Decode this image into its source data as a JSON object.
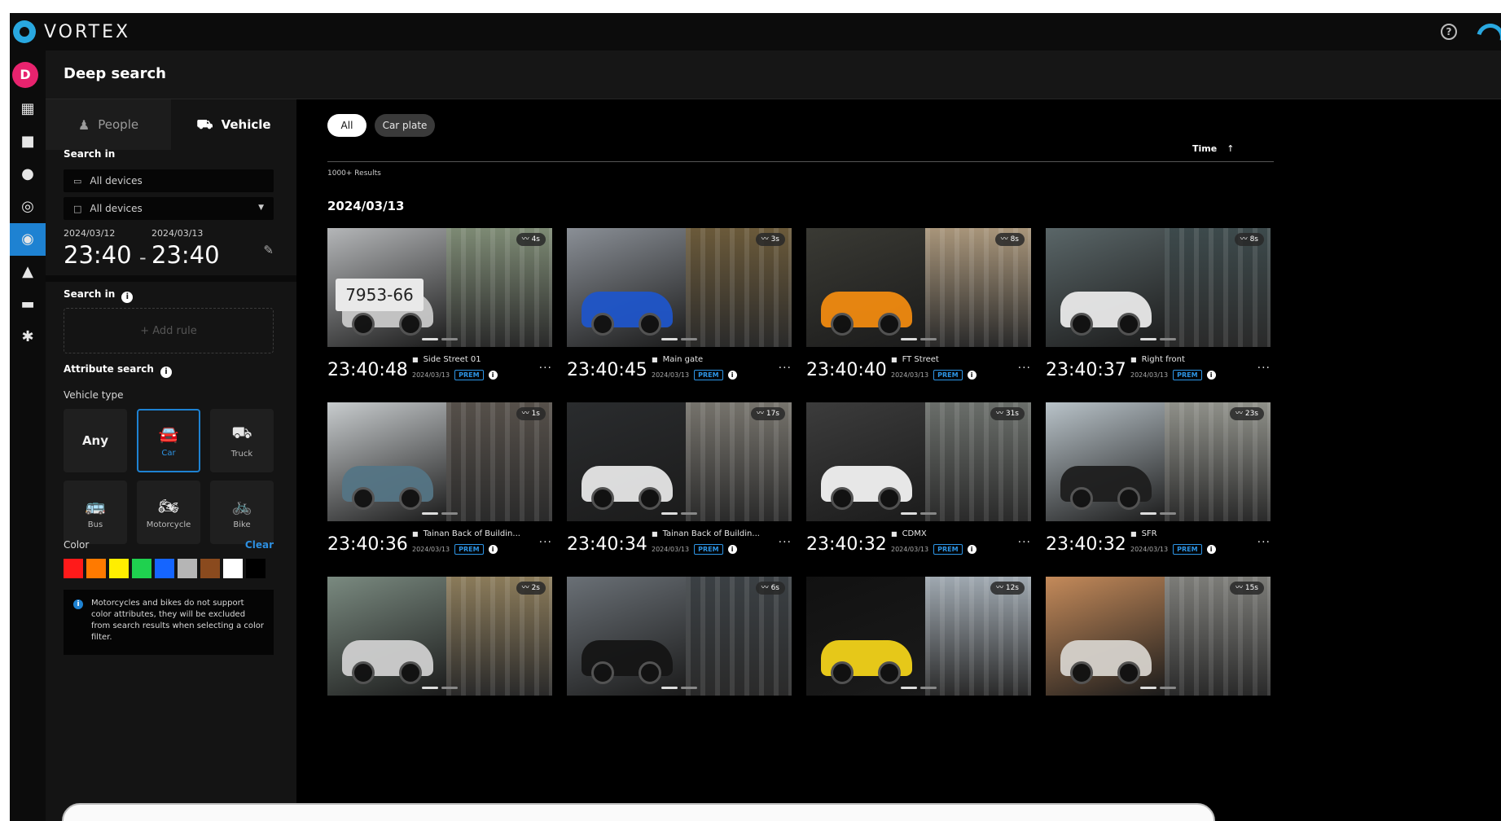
{
  "topbar": {
    "brand": "VORTEX",
    "help_icon": "?"
  },
  "rail": {
    "avatar": "D",
    "items": [
      {
        "name": "dashboard-icon",
        "glyph": "▦"
      },
      {
        "name": "camera-icon",
        "glyph": "■"
      },
      {
        "name": "person-icon",
        "glyph": "●"
      },
      {
        "name": "analytics-icon",
        "glyph": "◎"
      },
      {
        "name": "deep-search-icon",
        "glyph": "◉",
        "active": true
      },
      {
        "name": "bell-icon",
        "glyph": "▲"
      },
      {
        "name": "archive-icon",
        "glyph": "▬"
      },
      {
        "name": "settings-icon",
        "glyph": "✱"
      }
    ]
  },
  "page": {
    "title": "Deep search"
  },
  "panel": {
    "tabs": [
      {
        "label": "People",
        "icon": "♟",
        "active": false
      },
      {
        "label": "Vehicle",
        "icon": "⛟",
        "active": true
      }
    ],
    "search_in_label": "Search in",
    "devices_field_1": "All devices",
    "devices_field_2": "All devices",
    "date_from_small": "2024/03/12",
    "date_from_time": "23:40",
    "date_to_small": "2024/03/13",
    "date_to_time": "23:40",
    "date_sep": "-",
    "search_in_rules_label": "Search in",
    "add_rule": "+ Add rule",
    "attribute_search_label": "Attribute search",
    "vehicle_type_label": "Vehicle type",
    "vehicle_types": [
      {
        "label": "Any",
        "icon": "",
        "name": "vehicle-type-any"
      },
      {
        "label": "Car",
        "icon": "🚘",
        "name": "vehicle-type-car",
        "active": true
      },
      {
        "label": "Truck",
        "icon": "⛟",
        "name": "vehicle-type-truck"
      },
      {
        "label": "Bus",
        "icon": "🚌",
        "name": "vehicle-type-bus"
      },
      {
        "label": "Motorcycle",
        "icon": "🏍",
        "name": "vehicle-type-motorcycle"
      },
      {
        "label": "Bike",
        "icon": "🚲",
        "name": "vehicle-type-bike"
      }
    ],
    "color_label": "Color",
    "clear_label": "Clear",
    "colors": [
      "#ff1a1a",
      "#ff7a00",
      "#ffee00",
      "#1fd14f",
      "#1565ff",
      "#b5b5b5",
      "#8a4a1e",
      "#ffffff",
      "#000000"
    ],
    "notice": "Motorcycles and bikes do not support color attributes, they will be excluded from search results when selecting a color filter."
  },
  "results": {
    "chips": [
      {
        "label": "All",
        "active": true
      },
      {
        "label": "Car plate",
        "active": false
      }
    ],
    "sort_label": "Time",
    "sort_arrow": "↑",
    "count": "1000+ Results",
    "date_heading": "2024/03/13",
    "cards": [
      {
        "time": "23:40:48",
        "camera": "Side Street 01",
        "date": "2024/03/13",
        "badge": "PREM",
        "duration": "4s",
        "left_color": "#b4b6b8",
        "right_color": "#7d8a74",
        "car_color": "#c9c9c9",
        "plate": "7953-66"
      },
      {
        "time": "23:40:45",
        "camera": "Main gate",
        "date": "2024/03/13",
        "badge": "PREM",
        "duration": "3s",
        "left_color": "#8a8f96",
        "right_color": "#6b5a3a",
        "car_color": "#1f55c9",
        "plate": ""
      },
      {
        "time": "23:40:40",
        "camera": "FT Street",
        "date": "2024/03/13",
        "badge": "PREM",
        "duration": "8s",
        "left_color": "#3a3a34",
        "right_color": "#a8957a",
        "car_color": "#f08a10",
        "plate": ""
      },
      {
        "time": "23:40:37",
        "camera": "Right front",
        "date": "2024/03/13",
        "badge": "PREM",
        "duration": "8s",
        "left_color": "#5a6668",
        "right_color": "#3d4a4c",
        "car_color": "#e9e9e9",
        "plate": ""
      },
      {
        "time": "23:40:36",
        "camera": "Tainan Back of Buildin...",
        "date": "2024/03/13",
        "badge": "PREM",
        "duration": "1s",
        "left_color": "#c8ccce",
        "right_color": "#56504a",
        "car_color": "#557585",
        "plate": ""
      },
      {
        "time": "23:40:34",
        "camera": "Tainan Back of Buildin...",
        "date": "2024/03/13",
        "badge": "PREM",
        "duration": "17s",
        "left_color": "#2a2c2e",
        "right_color": "#76736c",
        "car_color": "#e6e6e6",
        "plate": ""
      },
      {
        "time": "23:40:32",
        "camera": "CDMX",
        "date": "2024/03/13",
        "badge": "PREM",
        "duration": "31s",
        "left_color": "#3c3c3c",
        "right_color": "#6a6e6a",
        "car_color": "#f2f2f2",
        "plate": ""
      },
      {
        "time": "23:40:32",
        "camera": "SFR",
        "date": "2024/03/13",
        "badge": "PREM",
        "duration": "23s",
        "left_color": "#b9c3c9",
        "right_color": "#8f9089",
        "car_color": "#1e1e1e",
        "plate": ""
      },
      {
        "time": "",
        "camera": "",
        "date": "",
        "badge": "",
        "duration": "2s",
        "left_color": "#7a8a80",
        "right_color": "#8b7b5a",
        "car_color": "#cfcfcf",
        "plate": ""
      },
      {
        "time": "",
        "camera": "",
        "date": "",
        "badge": "",
        "duration": "6s",
        "left_color": "#6a7076",
        "right_color": "#3b4044",
        "car_color": "#151515",
        "plate": ""
      },
      {
        "time": "",
        "camera": "",
        "date": "",
        "badge": "",
        "duration": "12s",
        "left_color": "#111111",
        "right_color": "#9fa8b0",
        "car_color": "#f2d21a",
        "plate": ""
      },
      {
        "time": "",
        "camera": "",
        "date": "",
        "badge": "",
        "duration": "15s",
        "left_color": "#c48a5a",
        "right_color": "#7c7c78",
        "car_color": "#d6d2cc",
        "plate": ""
      }
    ]
  }
}
